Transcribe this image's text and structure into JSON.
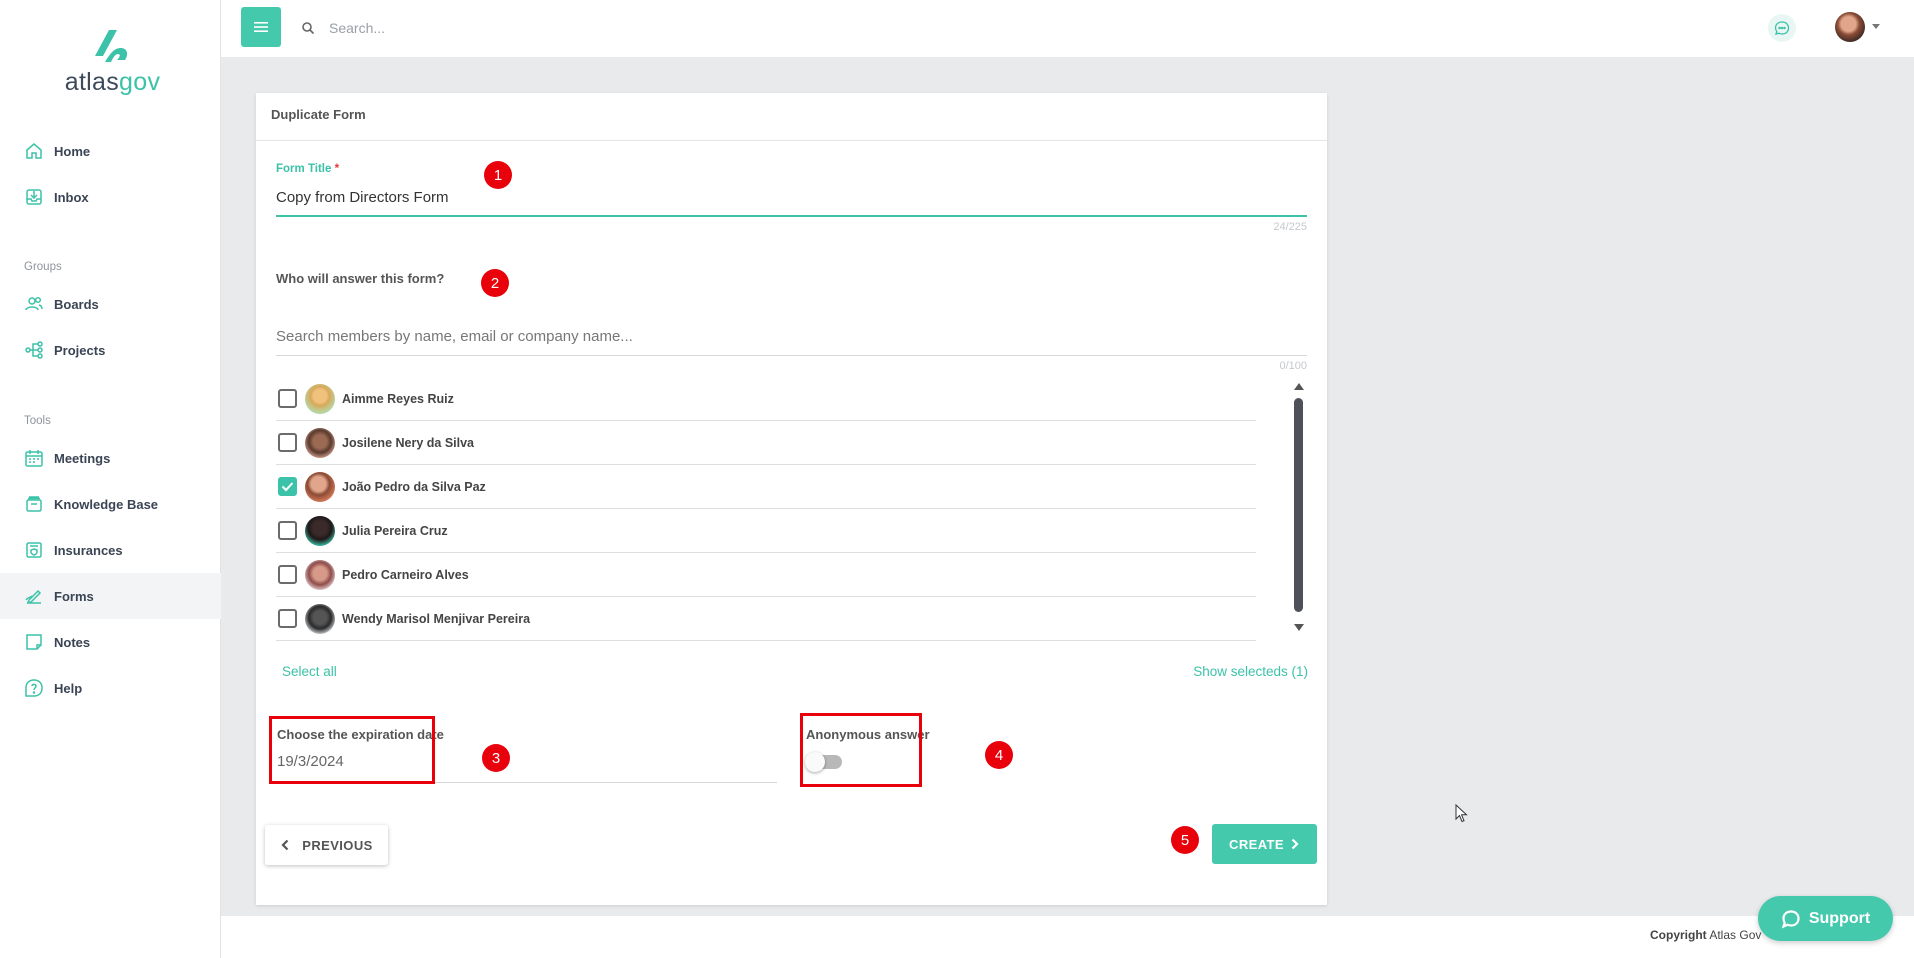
{
  "app": {
    "logo_atlas": "atlas",
    "logo_gov": "gov"
  },
  "sidebar": {
    "items": [
      {
        "label": "Home",
        "icon": "home-icon"
      },
      {
        "label": "Inbox",
        "icon": "inbox-icon"
      }
    ],
    "groups_title": "Groups",
    "group_items": [
      {
        "label": "Boards",
        "icon": "users-icon"
      },
      {
        "label": "Projects",
        "icon": "projects-icon"
      }
    ],
    "tools_title": "Tools",
    "tool_items": [
      {
        "label": "Meetings",
        "icon": "calendar-icon"
      },
      {
        "label": "Knowledge Base",
        "icon": "book-icon"
      },
      {
        "label": "Insurances",
        "icon": "insurance-icon"
      },
      {
        "label": "Forms",
        "icon": "forms-icon",
        "active": true
      },
      {
        "label": "Notes",
        "icon": "notes-icon"
      },
      {
        "label": "Help",
        "icon": "help-icon"
      }
    ]
  },
  "topbar": {
    "search_placeholder": "Search..."
  },
  "card": {
    "header": "Duplicate Form",
    "form_title_label": "Form Title",
    "required_mark": "*",
    "form_title_value": "Copy from Directors Form",
    "title_counter": "24/225",
    "audience_question": "Who will answer this form?",
    "member_search_placeholder": "Search members by name, email or company name...",
    "member_counter": "0/100",
    "members": [
      {
        "name": "Aimme Reyes Ruiz",
        "checked": false
      },
      {
        "name": "Josilene Nery da Silva",
        "checked": false
      },
      {
        "name": "João Pedro da Silva Paz",
        "checked": true
      },
      {
        "name": "Julia Pereira Cruz",
        "checked": false
      },
      {
        "name": "Pedro Carneiro Alves",
        "checked": false
      },
      {
        "name": "Wendy Marisol Menjivar Pereira",
        "checked": false
      }
    ],
    "select_all": "Select all",
    "show_selected": "Show selecteds (1)",
    "expiration_label": "Choose the expiration date",
    "expiration_value": "19/3/2024",
    "anonymous_label": "Anonymous answer",
    "anonymous_enabled": false,
    "previous_button": "PREVIOUS",
    "create_button": "CREATE"
  },
  "annotations": [
    "1",
    "2",
    "3",
    "4",
    "5"
  ],
  "footer": {
    "copyright_label": "Copyright",
    "copyright_text": "Atlas Gov"
  },
  "support_button": "Support",
  "colors": {
    "accent": "#45c9ad",
    "annotation": "#e8000b"
  }
}
